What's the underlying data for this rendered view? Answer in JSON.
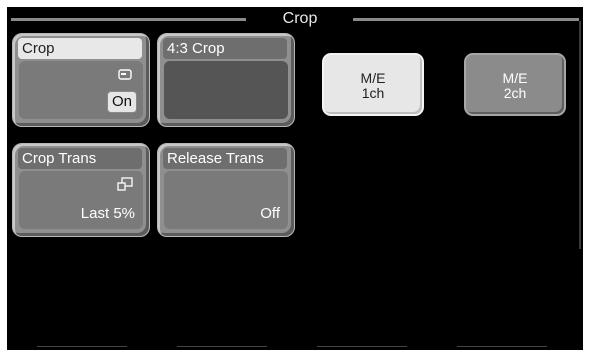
{
  "title": "Crop",
  "panels": {
    "crop": {
      "label": "Crop",
      "status": "On",
      "icon": "crop-mode-icon"
    },
    "crop_43": {
      "label": "4:3 Crop"
    },
    "crop_trans": {
      "label": "Crop Trans",
      "status": "Last 5%",
      "icon": "transition-icon"
    },
    "release_trans": {
      "label": "Release Trans",
      "status": "Off"
    }
  },
  "channels": [
    {
      "line1": "M/E",
      "line2": "1ch",
      "selected": true
    },
    {
      "line1": "M/E",
      "line2": "2ch",
      "selected": false
    }
  ],
  "colors": {
    "background": "#000000",
    "panel": "#8f8f8f",
    "selected": "#e7e7e7",
    "text_light": "#ffffff"
  }
}
